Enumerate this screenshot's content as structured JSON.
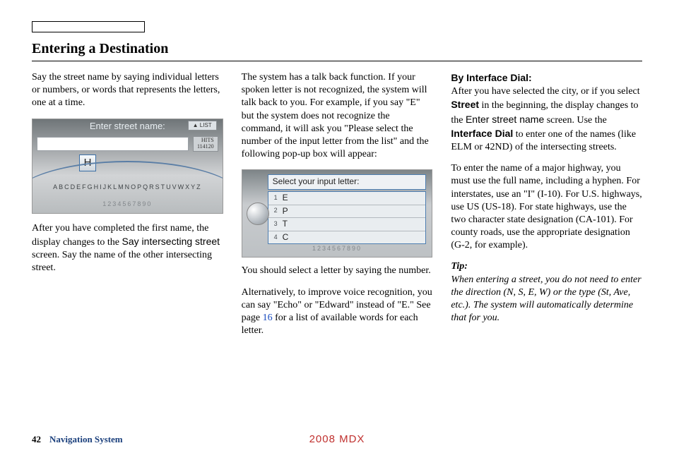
{
  "title": "Entering a Destination",
  "col1": {
    "p1": "Say the street name by saying individual letters or numbers, or words that represents the letters, one at a time.",
    "screen": {
      "title": "Enter street name:",
      "list_btn": "▲ LIST",
      "hits_label": "HITS",
      "hits_value": "114120",
      "selected_letter": "H",
      "alphabet": "ABCDEFGHIJKLMNOPQRSTUVWXYZ",
      "numbers": "1234567890"
    },
    "p2a": "After you have completed the first name, the display changes to the ",
    "p2b": "Say intersecting street",
    "p2c": " screen. Say the name of the other intersecting street."
  },
  "col2": {
    "p1": "The system has a talk back function. If your spoken letter is not recognized, the system will talk back to you. For example, if you say \"E\" but the system does not recognize the command, it will ask you \"Please select the number of the input letter from the list\" and the following pop-up box will appear:",
    "popup": {
      "header": "Select your input letter:",
      "rows": [
        {
          "num": "1",
          "letter": "E"
        },
        {
          "num": "2",
          "letter": "P"
        },
        {
          "num": "3",
          "letter": "T"
        },
        {
          "num": "4",
          "letter": "C"
        }
      ],
      "numbers": "1234567890"
    },
    "p2": "You should select a letter by saying the number.",
    "p3a": "Alternatively, to improve voice recognition, you can say \"Echo\" or \"Edward\" instead of \"E.\" See page ",
    "p3b": "16",
    "p3c": " for a list of available words for each letter."
  },
  "col3": {
    "h1": "By Interface Dial:",
    "p1a": "After you have selected the city, or if you select ",
    "p1b": "Street",
    "p1c": " in the beginning, the display changes to the ",
    "p1d": "Enter street name",
    "p1e": " screen. Use the ",
    "p1f": "Interface Dial",
    "p1g": " to enter one of the names (like ELM or 42ND) of the intersecting streets.",
    "p2": "To enter the name of a major highway, you must use the full name, including a hyphen. For interstates, use an \"I\" (I-10). For U.S. highways, use US (US-18). For state highways, use the two character state designation (CA-101). For county roads, use the appropriate designation (G-2, for example).",
    "tip_label": "Tip:",
    "tip_body": "When entering a street, you do not need to enter the direction (N, S, E, W) or the type (St, Ave, etc.). The system will automatically determine that for you."
  },
  "footer": {
    "page": "42",
    "section": "Navigation System",
    "model": "2008 MDX"
  }
}
